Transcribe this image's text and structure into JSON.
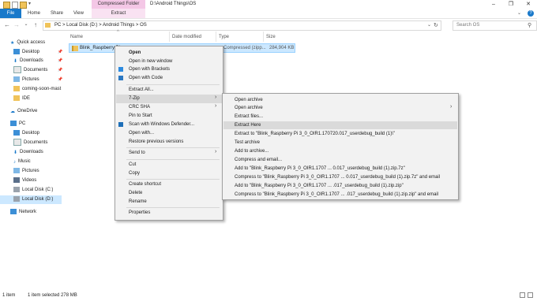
{
  "title_bar": {
    "context_tab": "Compressed Folder Tools",
    "window_title": "D:\\Android Things\\OS"
  },
  "ribbon": {
    "tabs": [
      "File",
      "Home",
      "Share",
      "View",
      "Extract"
    ]
  },
  "address_bar": {
    "crumbs": "PC  >  Local Disk (D:)  >  Android Things  >  OS",
    "search_placeholder": "Search OS"
  },
  "nav_pane": {
    "items": [
      {
        "label": "Quick access",
        "icon": "star-icon"
      },
      {
        "label": "Desktop",
        "icon": "desktop-icon",
        "pinned": true
      },
      {
        "label": "Downloads",
        "icon": "download-icon",
        "pinned": true
      },
      {
        "label": "Documents",
        "icon": "documents-icon",
        "pinned": true
      },
      {
        "label": "Pictures",
        "icon": "pictures-icon",
        "pinned": true
      },
      {
        "label": "coming-soon-mast",
        "icon": "folder-icon"
      },
      {
        "label": "IDE",
        "icon": "folder-icon"
      },
      {
        "label": "OneDrive",
        "icon": "cloud-icon"
      },
      {
        "label": "PC",
        "icon": "pc-icon"
      },
      {
        "label": "Desktop",
        "icon": "desktop-icon"
      },
      {
        "label": "Documents",
        "icon": "documents-icon"
      },
      {
        "label": "Downloads",
        "icon": "download-icon"
      },
      {
        "label": "Music",
        "icon": "music-icon"
      },
      {
        "label": "Pictures",
        "icon": "pictures-icon"
      },
      {
        "label": "Videos",
        "icon": "videos-icon"
      },
      {
        "label": "Local Disk (C:)",
        "icon": "drive-icon"
      },
      {
        "label": "Local Disk (D:)",
        "icon": "drive-icon"
      },
      {
        "label": "Network",
        "icon": "network-icon"
      }
    ]
  },
  "file_list": {
    "columns": [
      "Name",
      "Date modified",
      "Type",
      "Size"
    ],
    "rows": [
      {
        "name": "Blink_Raspberry Pi",
        "type": "Compressed (zipp...",
        "size": "284,904 KB"
      }
    ]
  },
  "context_menu": {
    "items": [
      "Open",
      "Open in new window",
      "Open with Brackets",
      "Open with Code",
      "Extract All...",
      "7-Zip",
      "CRC SHA",
      "Pin to Start",
      "Scan with Windows Defender...",
      "Open with...",
      "Restore previous versions",
      "Send to",
      "Cut",
      "Copy",
      "Create shortcut",
      "Delete",
      "Rename",
      "Properties"
    ]
  },
  "zip_submenu": {
    "items": [
      "Open archive",
      "Open archive",
      "Extract files...",
      "Extract Here",
      "Extract to \"Blink_Raspberry Pi 3_0_OIR1.170720.017_userdebug_build (1)\\\"",
      "Test archive",
      "Add to archive...",
      "Compress and email...",
      "Add to \"Blink_Raspberry Pi 3_0_OIR1.1707 ... 0.017_userdebug_build (1).zip.7z\"",
      "Compress to \"Blink_Raspberry Pi 3_0_OIR1.1707 ... 0.017_userdebug_build (1).zip.7z\" and email",
      "Add to \"Blink_Raspberry Pi 3_0_OIR1.1707 ... .017_userdebug_build (1).zip.zip\"",
      "Compress to \"Blink_Raspberry Pi 3_0_OIR1.1707 ... .017_userdebug_build (1).zip.zip\" and email"
    ]
  },
  "status_bar": {
    "item_count": "1 item",
    "selection": "1 item selected  278 MB"
  },
  "colors": {
    "file_tab": "#1979ca",
    "context_tab": "#f4c7e6",
    "selection": "#cce8ff",
    "menu_bg": "#f2f2f2",
    "menu_hover": "#dadada"
  }
}
